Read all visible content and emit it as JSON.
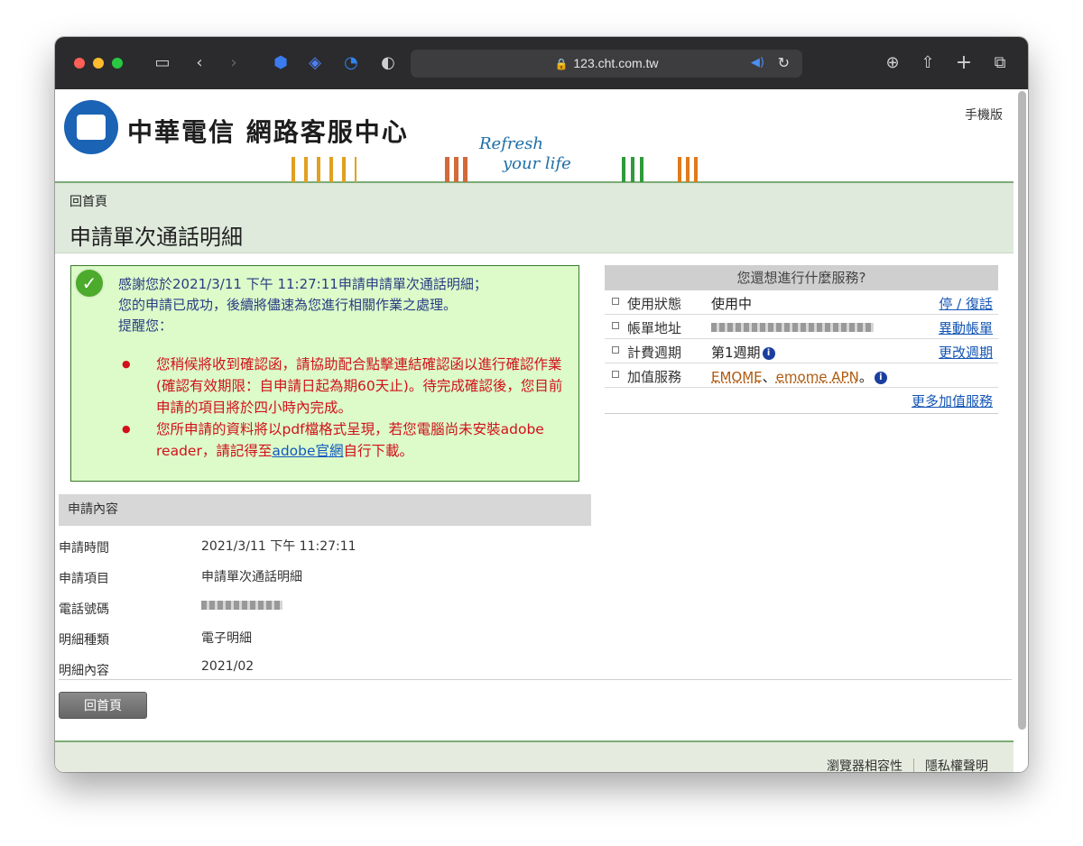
{
  "browser": {
    "url": "123.cht.com.tw"
  },
  "header": {
    "logo_text": "中華電信 網路客服中心",
    "slogan_line1": "Refresh",
    "slogan_line2": "your life",
    "mobile_link": "手機版"
  },
  "breadcrumb": "回首頁",
  "page_title": "申請單次通話明細",
  "success": {
    "line1": "感謝您於2021/3/11 下午 11:27:11申請申請單次通話明細；",
    "line2": "您的申請已成功，後續將儘速為您進行相關作業之處理。",
    "line3": "提醒您：",
    "bullet1": "您稍候將收到確認函，請協助配合點擊連結確認函以進行確認作業(確認有效期限：自申請日起為期60天止)。待完成確認後，您目前申請的項目將於四小時內完成。",
    "bullet2_pre": "您所申請的資料將以pdf檔格式呈現，若您電腦尚未安裝adobe reader，請記得至",
    "bullet2_link": "adobe官網",
    "bullet2_post": "自行下載。"
  },
  "details": {
    "header": "申請內容",
    "rows": [
      {
        "label": "申請時間",
        "value": "2021/3/11 下午 11:27:11"
      },
      {
        "label": "申請項目",
        "value": "申請單次通話明細"
      },
      {
        "label": "電話號碼",
        "value": ""
      },
      {
        "label": "明細種類",
        "value": "電子明細"
      },
      {
        "label": "明細內容",
        "value": "2021/02"
      }
    ],
    "home_button": "回首頁"
  },
  "panel": {
    "title": "您還想進行什麼服務?",
    "rows": [
      {
        "label": "使用狀態",
        "value": "使用中",
        "action": "停 / 復話"
      },
      {
        "label": "帳單地址",
        "value": "",
        "action": "異動帳單"
      },
      {
        "label": "計費週期",
        "value": "第1週期",
        "action": "更改週期"
      },
      {
        "label": "加值服務",
        "value_link1": "EMOME",
        "value_sep": "、",
        "value_link2": "emome APN",
        "value_end": "。",
        "action": ""
      }
    ],
    "more_link": "更多加值服務"
  },
  "footer": {
    "link1": "瀏覽器相容性",
    "link2": "隱私權聲明"
  }
}
